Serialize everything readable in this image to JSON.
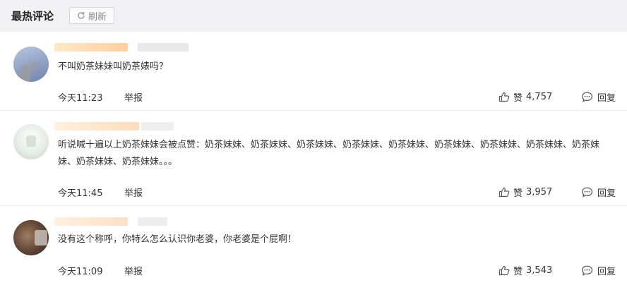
{
  "header": {
    "title": "最热评论",
    "refresh_label": "刷新"
  },
  "comments": [
    {
      "text": "不叫奶茶妹妹叫奶茶婊吗？",
      "time": "今天11:23",
      "report_label": "举报",
      "like_label": "赞",
      "like_count": "4,757",
      "reply_label": "回复"
    },
    {
      "text": "听说喊十遍以上奶茶妹妹会被点赞：奶茶妹妹、奶茶妹妹、奶茶妹妹、奶茶妹妹、奶茶妹妹、奶茶妹妹、奶茶妹妹、奶茶妹妹、奶茶妹妹、奶茶妹妹、奶茶妹妹。。。",
      "time": "今天11:45",
      "report_label": "举报",
      "like_label": "赞",
      "like_count": "3,957",
      "reply_label": "回复"
    },
    {
      "text": "没有这个称呼，你特么怎么认识你老婆，你老婆是个屁啊！",
      "time": "今天11:09",
      "report_label": "举报",
      "like_label": "赞",
      "like_count": "3,543",
      "reply_label": "回复"
    }
  ],
  "icons": {
    "refresh": "refresh-icon",
    "like": "thumbs-up-icon",
    "reply": "comment-bubble-icon"
  }
}
